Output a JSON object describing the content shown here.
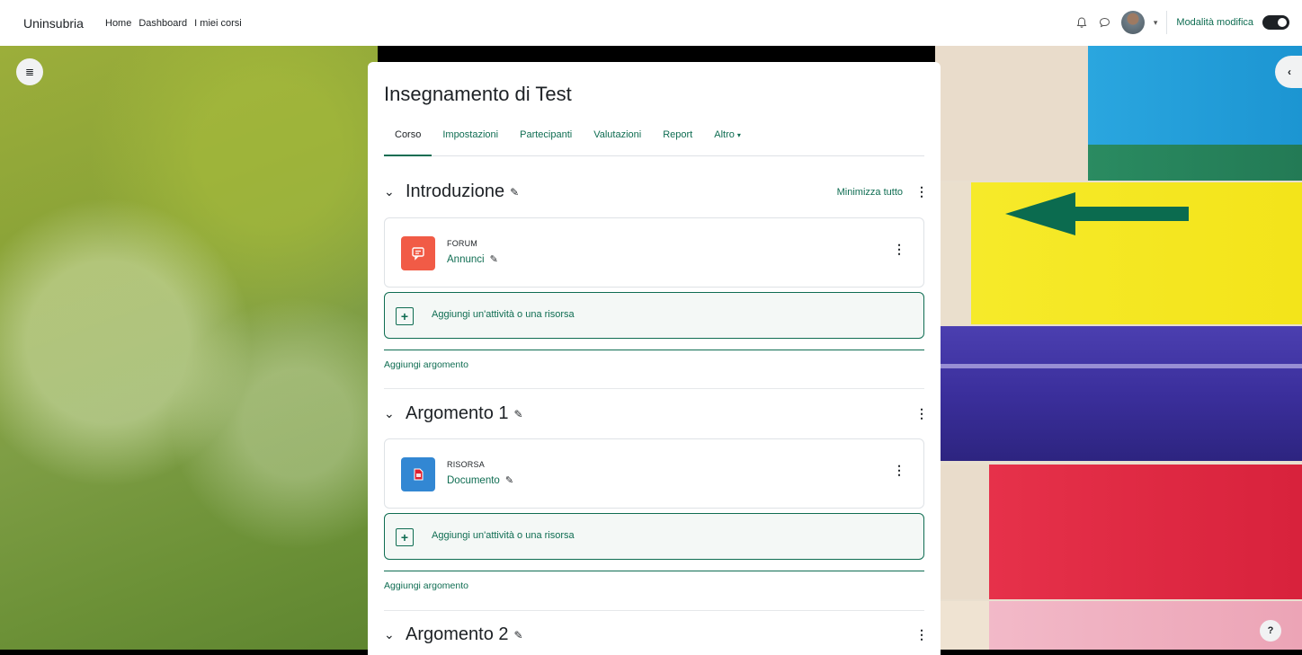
{
  "navbar": {
    "brand": "Uninsubria",
    "links": [
      "Home",
      "Dashboard",
      "I miei corsi"
    ],
    "edit_mode_label": "Modalità modifica",
    "edit_mode_on": true,
    "icons": [
      "bell-icon",
      "chat-icon",
      "avatar",
      "chevron-down-icon"
    ]
  },
  "course": {
    "title": "Insegnamento di Test",
    "tabs": [
      "Corso",
      "Impostazioni",
      "Partecipanti",
      "Valutazioni",
      "Report",
      "Altro"
    ],
    "active_tab": "Corso",
    "more_icon": "chevron-down-icon"
  },
  "sections": [
    {
      "title": "Introduzione",
      "collapse_all": "Minimizza tutto",
      "activity": {
        "type": "FORUM",
        "name": "Annunci",
        "icon": "forum-icon",
        "color": "#f15b46"
      },
      "add_activity": "Aggiungi un'attività o una risorsa",
      "add_topic": "Aggiungi argomento"
    },
    {
      "title": "Argomento 1",
      "activity": {
        "type": "RISORSA",
        "name": "Documento",
        "icon": "pdf-icon",
        "color": "#3287d3"
      },
      "add_activity": "Aggiungi un'attività o una risorsa",
      "add_topic": "Aggiungi argomento"
    },
    {
      "title": "Argomento 2"
    }
  ],
  "help": "?",
  "colors": {
    "accent": "#0f6d52",
    "arrow": "#0b6b4f"
  }
}
